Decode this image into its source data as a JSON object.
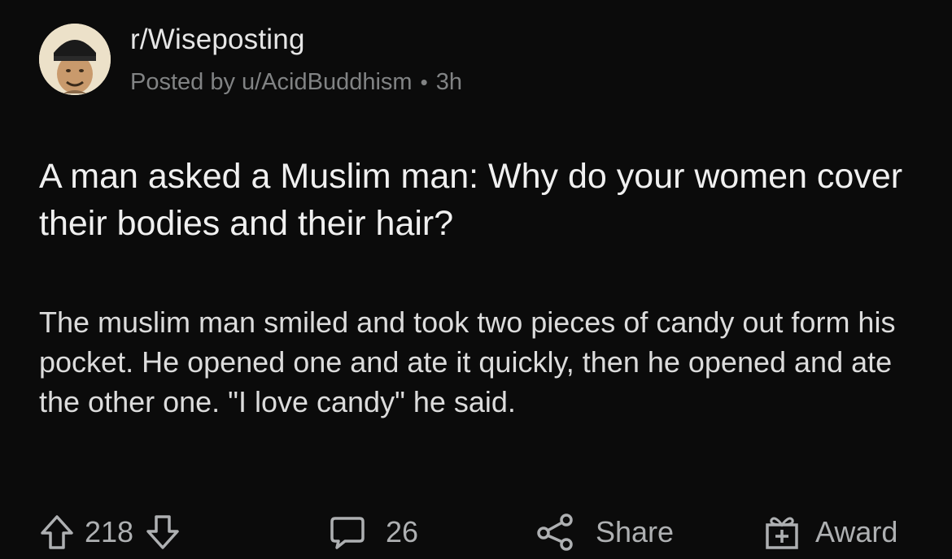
{
  "post": {
    "subreddit": "r/Wiseposting",
    "author_line": "Posted by u/AcidBuddhism",
    "separator": "•",
    "age": "3h",
    "title": "A man asked a Muslim man: Why do your women cover their bodies and their hair?",
    "body": "The muslim man smiled and took two pieces of candy out form his pocket. He opened one and ate it quickly, then he opened and ate the other one. \"I love candy\" he said."
  },
  "actions": {
    "upvote_icon": "upvote-arrow-icon",
    "vote_count": "218",
    "downvote_icon": "downvote-arrow-icon",
    "comment_icon": "comment-bubble-icon",
    "comment_count": "26",
    "share_icon": "share-icon",
    "share_label": "Share",
    "award_icon": "gift-box-icon",
    "award_label": "Award"
  },
  "colors": {
    "background": "#0b0b0b",
    "text_primary": "#f0f0f0",
    "text_secondary": "#818384",
    "action_text": "#aeb0b2"
  }
}
